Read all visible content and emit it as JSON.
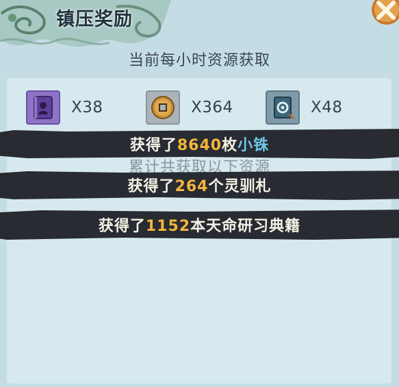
{
  "header": {
    "title": "镇压奖励"
  },
  "subtitle": "当前每小时资源获取",
  "resources": [
    {
      "icon": "purple-book-icon",
      "count": "X38"
    },
    {
      "icon": "copper-coin-icon",
      "count": "X364"
    },
    {
      "icon": "blue-tome-icon",
      "count": "X48"
    }
  ],
  "accumulated_label": "累计共获取以下资源",
  "rewards": [
    {
      "prefix": "获得了",
      "amount": "8640",
      "unit": "枚",
      "item": "小铢",
      "item_color": "#71c7ea"
    },
    {
      "prefix": "获得了",
      "amount": "264",
      "unit": "个",
      "item": "灵驯札",
      "item_color": "#f4f1e6"
    },
    {
      "prefix": "获得了",
      "amount": "1152",
      "unit": "本",
      "item": "天命研习典籍",
      "item_color": "#f4f1e6"
    }
  ],
  "colors": {
    "panel_bg": "#c4dde5",
    "inner_bg": "#d6e9ef",
    "amount": "#f2b53c",
    "banner_bg": "#1f2126"
  }
}
